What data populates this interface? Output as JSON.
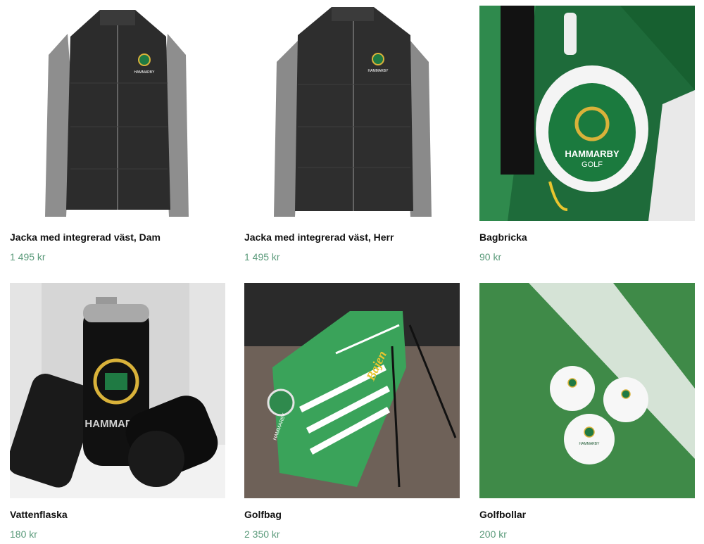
{
  "products": [
    {
      "name": "Jacka med integrerad väst, Dam",
      "price": "1 495 kr",
      "image": "womens-jacket-image"
    },
    {
      "name": "Jacka med integrerad väst, Herr",
      "price": "1 495 kr",
      "image": "mens-jacket-image"
    },
    {
      "name": "Bagbricka",
      "price": "90 kr",
      "image": "bag-tag-image"
    },
    {
      "name": "Vattenflaska",
      "price": "180 kr",
      "image": "water-bottle-image"
    },
    {
      "name": "Golfbag",
      "price": "2 350 kr",
      "image": "golf-bag-image"
    },
    {
      "name": "Golfbollar",
      "price": "200 kr",
      "image": "golf-balls-image"
    }
  ],
  "images": {
    "logo_text_top": "HAMMARBY",
    "logo_text_bottom": "GOLF",
    "bag_script": "Bajen"
  },
  "colors": {
    "price": "#5a9a7a",
    "brand_green": "#1f7a43",
    "jacket_dark": "#2b2b2b",
    "sleeve_grey": "#8c8c8c"
  }
}
